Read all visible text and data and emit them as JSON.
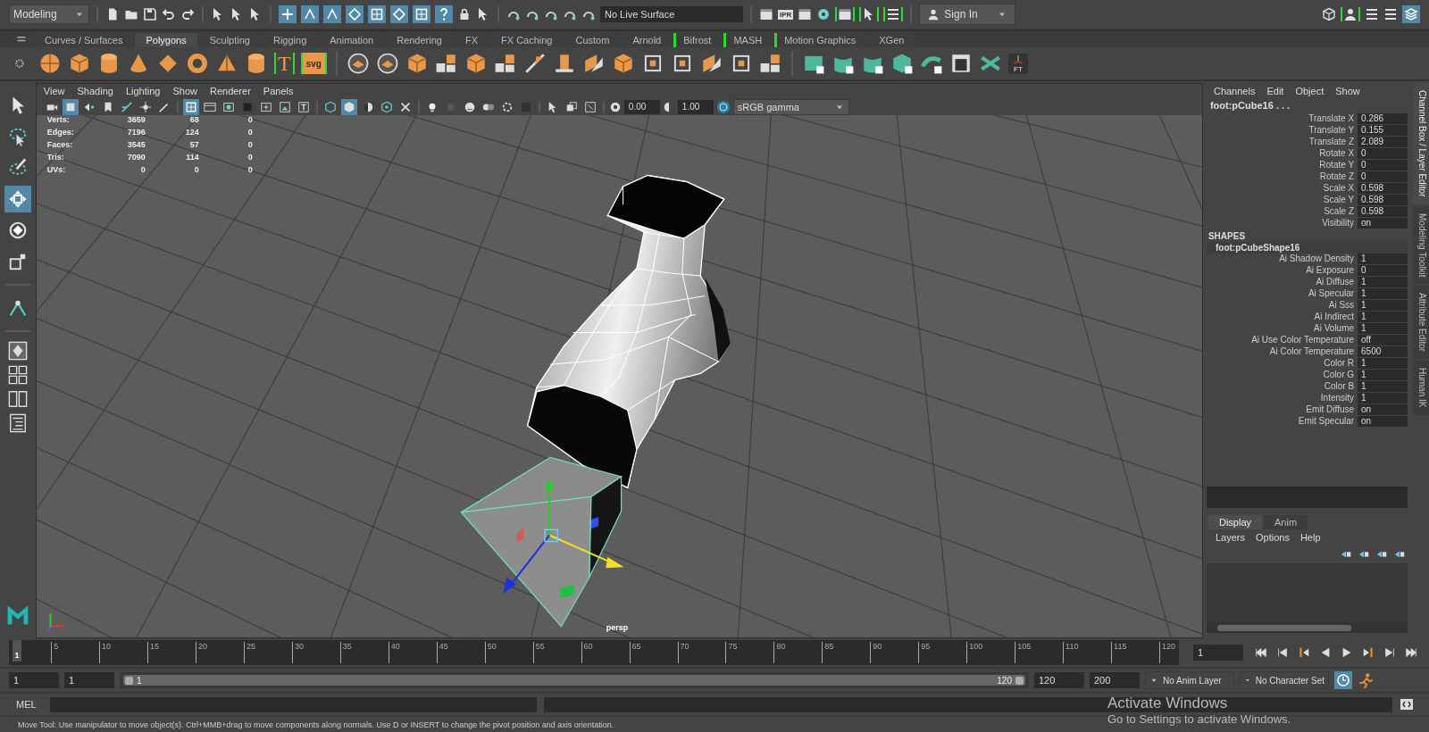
{
  "status_line": {
    "mode": "Modeling",
    "snap_toggles": [
      {
        "on": true
      },
      {
        "on": true
      },
      {
        "on": true
      },
      {
        "on": true
      },
      {
        "on": true
      },
      {
        "on": true
      },
      {
        "on": true
      },
      {
        "on": true
      }
    ],
    "live_surface": "No Live Surface",
    "ipr_label": "IPR",
    "sign_in": "Sign In",
    "layers_toggle": {
      "on": true
    }
  },
  "shelf": {
    "tabs": [
      {
        "label": "Curves / Surfaces",
        "selected": false,
        "marked": false
      },
      {
        "label": "Polygons",
        "selected": true,
        "marked": false
      },
      {
        "label": "Sculpting",
        "selected": false,
        "marked": false
      },
      {
        "label": "Rigging",
        "selected": false,
        "marked": false
      },
      {
        "label": "Animation",
        "selected": false,
        "marked": false
      },
      {
        "label": "Rendering",
        "selected": false,
        "marked": false
      },
      {
        "label": "FX",
        "selected": false,
        "marked": false
      },
      {
        "label": "FX Caching",
        "selected": false,
        "marked": false
      },
      {
        "label": "Custom",
        "selected": false,
        "marked": false
      },
      {
        "label": "Arnold",
        "selected": false,
        "marked": false
      },
      {
        "label": "Bifrost",
        "selected": false,
        "marked": true
      },
      {
        "label": "MASH",
        "selected": false,
        "marked": true
      },
      {
        "label": "Motion Graphics",
        "selected": false,
        "marked": true
      },
      {
        "label": "XGen",
        "selected": false,
        "marked": false
      }
    ],
    "text_icons": [
      "T",
      "svg"
    ],
    "axis_icon_label": "FT"
  },
  "toolbox": {
    "tools": [
      {
        "kind": "select",
        "selected": false
      },
      {
        "kind": "lasso",
        "selected": false
      },
      {
        "kind": "paint",
        "selected": false
      },
      {
        "kind": "move",
        "selected": true
      },
      {
        "kind": "rotate",
        "selected": false
      },
      {
        "kind": "scale",
        "selected": false
      },
      {
        "kind": "soft",
        "selected": false
      }
    ]
  },
  "viewport": {
    "menus": [
      "View",
      "Shading",
      "Lighting",
      "Show",
      "Renderer",
      "Panels"
    ],
    "toolbar_toggles": [
      {
        "on": false
      },
      {
        "on": true
      },
      {
        "on": false
      },
      {
        "on": false
      },
      {
        "on": false
      },
      {
        "on": false
      },
      {
        "on": false
      },
      {
        "on": true
      },
      {
        "on": false
      },
      {
        "on": false
      },
      {
        "on": false
      },
      {
        "on": false
      },
      {
        "on": false
      },
      {
        "on": false
      },
      {
        "on": false
      },
      {
        "on": true
      },
      {
        "on": false
      },
      {
        "on": false
      },
      {
        "on": false
      },
      {
        "on": false
      },
      {
        "on": false
      },
      {
        "on": false
      },
      {
        "on": false
      },
      {
        "on": false
      },
      {
        "on": false
      },
      {
        "on": false
      },
      {
        "on": false
      },
      {
        "on": false
      }
    ],
    "exposure": "0.00",
    "gamma": "1.00",
    "color_space": "sRGB gamma",
    "stats": [
      {
        "label": "Verts:",
        "values": [
          "3659",
          "68",
          "0"
        ]
      },
      {
        "label": "Edges:",
        "values": [
          "7196",
          "124",
          "0"
        ]
      },
      {
        "label": "Faces:",
        "values": [
          "3545",
          "57",
          "0"
        ]
      },
      {
        "label": "Tris:",
        "values": [
          "7090",
          "114",
          "0"
        ]
      },
      {
        "label": "UVs:",
        "values": [
          "0",
          "0",
          "0"
        ]
      }
    ],
    "camera": "persp"
  },
  "channel_box": {
    "menus": [
      "Channels",
      "Edit",
      "Object",
      "Show"
    ],
    "object": "foot:pCube16 . . .",
    "channels": [
      {
        "name": "Translate X",
        "value": "0.286"
      },
      {
        "name": "Translate Y",
        "value": "0.155"
      },
      {
        "name": "Translate Z",
        "value": "2.089"
      },
      {
        "name": "Rotate X",
        "value": "0"
      },
      {
        "name": "Rotate Y",
        "value": "0"
      },
      {
        "name": "Rotate Z",
        "value": "0"
      },
      {
        "name": "Scale X",
        "value": "0.598"
      },
      {
        "name": "Scale Y",
        "value": "0.598"
      },
      {
        "name": "Scale Z",
        "value": "0.598"
      },
      {
        "name": "Visibility",
        "value": "on"
      }
    ],
    "shapes_heading": "SHAPES",
    "shape": "foot:pCubeShape16",
    "shape_channels": [
      {
        "name": "Ai Shadow Density",
        "value": "1"
      },
      {
        "name": "Ai Exposure",
        "value": "0"
      },
      {
        "name": "Ai Diffuse",
        "value": "1"
      },
      {
        "name": "Ai Specular",
        "value": "1"
      },
      {
        "name": "Ai Sss",
        "value": "1"
      },
      {
        "name": "Ai Indirect",
        "value": "1"
      },
      {
        "name": "Ai Volume",
        "value": "1"
      },
      {
        "name": "Ai Use Color Temperature",
        "value": "off"
      },
      {
        "name": "Ai Color Temperature",
        "value": "6500"
      },
      {
        "name": "Color R",
        "value": "1"
      },
      {
        "name": "Color G",
        "value": "1"
      },
      {
        "name": "Color B",
        "value": "1"
      },
      {
        "name": "Intensity",
        "value": "1"
      },
      {
        "name": "Emit Diffuse",
        "value": "on"
      },
      {
        "name": "Emit Specular",
        "value": "on"
      }
    ]
  },
  "layer_editor": {
    "tabs": [
      {
        "label": "Display",
        "selected": true
      },
      {
        "label": "Anim",
        "selected": false
      }
    ],
    "menus": [
      "Layers",
      "Options",
      "Help"
    ]
  },
  "side_tabs": [
    {
      "label": "Channel Box / Layer Editor",
      "selected": true
    },
    {
      "label": "Modeling Toolkit",
      "selected": false
    },
    {
      "label": "Attribute Editor",
      "selected": false
    },
    {
      "label": "Human IK",
      "selected": false
    }
  ],
  "time_slider": {
    "ticks": [
      "5",
      "10",
      "15",
      "20",
      "25",
      "30",
      "35",
      "40",
      "45",
      "50",
      "55",
      "60",
      "65",
      "70",
      "75",
      "80",
      "85",
      "90",
      "95",
      "100",
      "105",
      "110",
      "115",
      "120"
    ],
    "current_frame": "1",
    "level": 0,
    "frame_field": "1"
  },
  "range": {
    "start": "1",
    "playback_start": "1",
    "range_start": "1",
    "range_end": "120",
    "level": 1,
    "playback_end": "120",
    "end": "200",
    "anim_layer": "No Anim Layer",
    "character_set": "No Character Set"
  },
  "command_line": {
    "language": "MEL"
  },
  "help_line": "Move Tool: Use manipulator to move object(s). Ctrl+MMB+drag to move components along normals. Use D or INSERT to change the pivot position and axis orientation.",
  "os_notice": {
    "title": "Activate Windows",
    "message": "Go to Settings to activate Windows."
  }
}
